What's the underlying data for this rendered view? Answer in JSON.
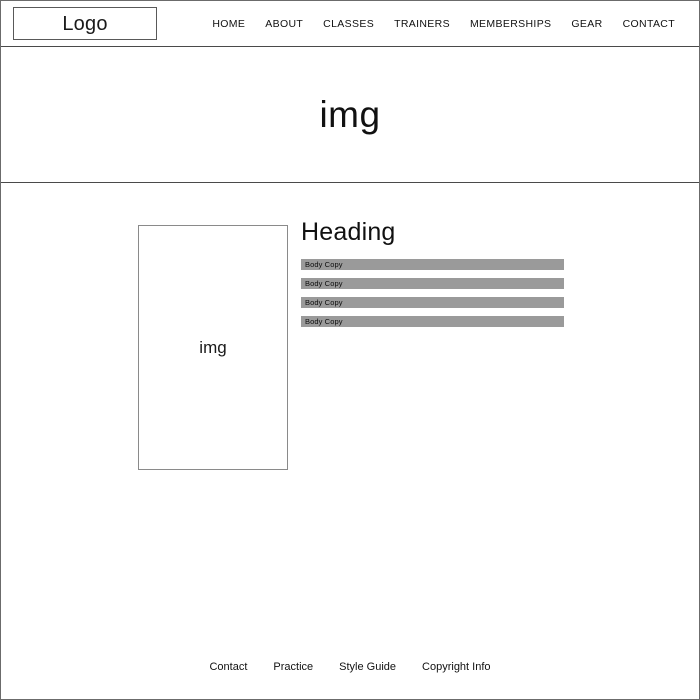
{
  "header": {
    "logo": {
      "label": "Logo"
    },
    "nav": {
      "items": [
        {
          "label": "HOME"
        },
        {
          "label": "ABOUT"
        },
        {
          "label": "CLASSES"
        },
        {
          "label": "TRAINERS"
        },
        {
          "label": "MEMBERSHIPS"
        },
        {
          "label": "GEAR"
        },
        {
          "label": "CONTACT"
        }
      ]
    }
  },
  "hero": {
    "placeholder_label": "img"
  },
  "main": {
    "image_placeholder": {
      "label": "img"
    },
    "heading": "Heading",
    "body_bars": [
      {
        "label": "Body Copy"
      },
      {
        "label": "Body Copy"
      },
      {
        "label": "Body Copy"
      },
      {
        "label": "Body Copy"
      }
    ]
  },
  "footer": {
    "links": [
      {
        "label": "Contact"
      },
      {
        "label": "Practice"
      },
      {
        "label": "Style Guide"
      },
      {
        "label": "Copyright Info"
      }
    ]
  },
  "colors": {
    "page_border": "#6b6b6b",
    "divider": "#4a4a4a",
    "bar_fill": "#9a9a9a",
    "box_border": "#8a8a8a",
    "text": "#111111",
    "background": "#ffffff"
  }
}
